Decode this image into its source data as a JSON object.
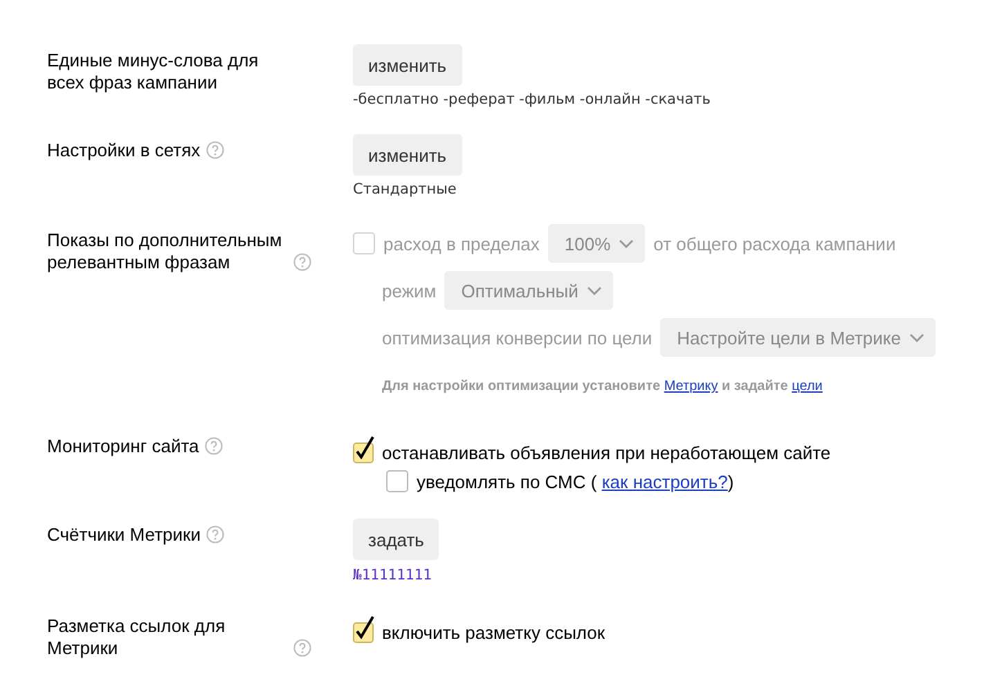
{
  "settings": [
    {
      "kind": "button",
      "label": "Единые минус-слова для всех фраз кампании",
      "help": false,
      "button": "изменить",
      "note": "-бесплатно -реферат -фильм -онлайн -скачать",
      "note_link": false
    },
    {
      "kind": "button",
      "label": "Настройки в сетях",
      "help": true,
      "button": "изменить",
      "note": "Стандартные",
      "note_link": false
    },
    {
      "kind": "extra_phrases",
      "label": "Показы по дополнительным релевантным фразам",
      "help": true,
      "disabled": true,
      "spend": {
        "label": "расход в пределах",
        "checked": false,
        "select": "100%",
        "after": "от общего расхода кампании"
      },
      "mode": {
        "label": "режим",
        "select": "Оптимальный"
      },
      "goal": {
        "label": "оптимизация конверсии по цели",
        "select": "Настройте цели в Метрике"
      },
      "hint": [
        {
          "kind": "text",
          "text": "Для настройки оптимизации установите "
        },
        {
          "kind": "link",
          "text": "Метрику"
        },
        {
          "kind": "text",
          "text": " и задайте "
        },
        {
          "kind": "link",
          "text": "цели"
        }
      ]
    },
    {
      "kind": "checks",
      "label": "Мониторинг сайта",
      "help": true,
      "items": [
        {
          "label": "останавливать объявления при неработающем сайте",
          "checked": true,
          "children": [
            {
              "label": "уведомлять по СМС (",
              "checked": false,
              "link": "как настроить?",
              "after": ")"
            }
          ]
        }
      ]
    },
    {
      "kind": "button",
      "label": "Счётчики Метрики",
      "help": true,
      "button": "задать",
      "note": "№11111111",
      "note_link": true
    },
    {
      "kind": "checks",
      "label": "Разметка ссылок для Метрики",
      "help": true,
      "items": [
        {
          "label": "включить разметку ссылок",
          "checked": true
        }
      ]
    }
  ]
}
